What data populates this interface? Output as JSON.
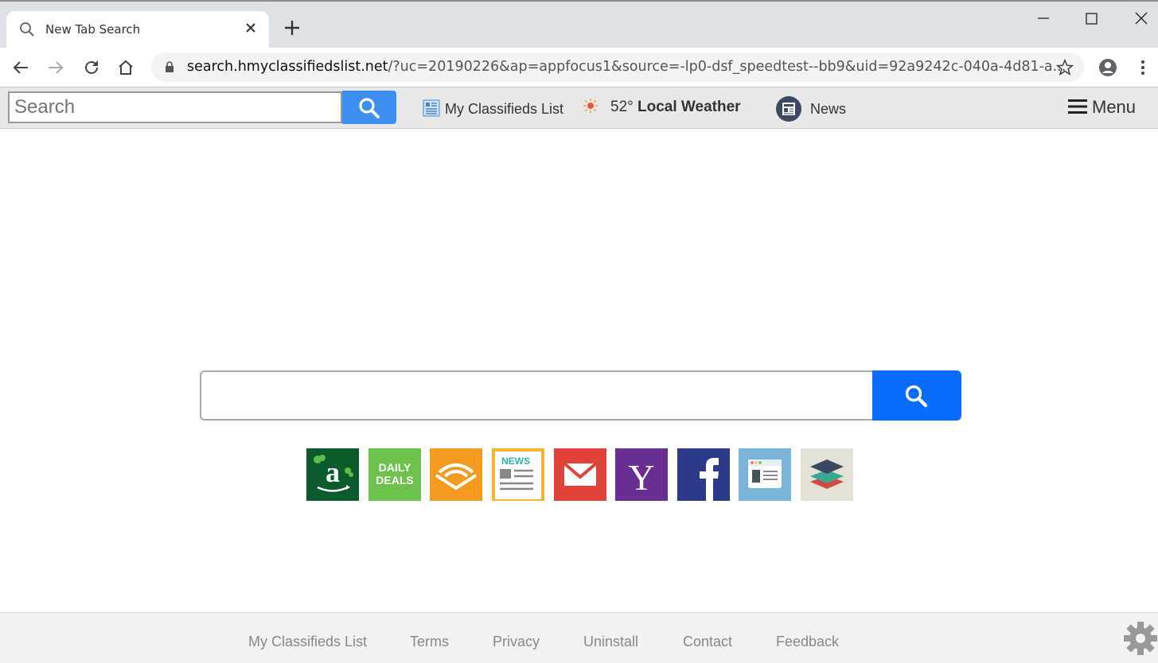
{
  "browser": {
    "tab_title": "New Tab Search",
    "url_host": "search.hmyclassifiedslist.net",
    "url_rest": "/?uc=20190226&ap=appfocus1&source=-lp0-dsf_speedtest--bb9&uid=92a9242c-040a-4d81-a..."
  },
  "toolbar": {
    "search_placeholder": "Search",
    "classifieds_label": "My Classifieds List",
    "temperature": "52°",
    "weather_label": "Local Weather",
    "news_label": "News",
    "menu_label": "Menu"
  },
  "main": {
    "search_value": "",
    "tiles": [
      "amazon",
      "daily-deals",
      "audible",
      "news",
      "gmail",
      "yahoo",
      "facebook",
      "browser-window",
      "layers"
    ]
  },
  "footer": {
    "links": [
      "My Classifieds List",
      "Terms",
      "Privacy",
      "Uninstall",
      "Contact",
      "Feedback"
    ]
  },
  "colors": {
    "accent": "#0a6cff",
    "toolbar_btn": "#3d8ef0"
  }
}
